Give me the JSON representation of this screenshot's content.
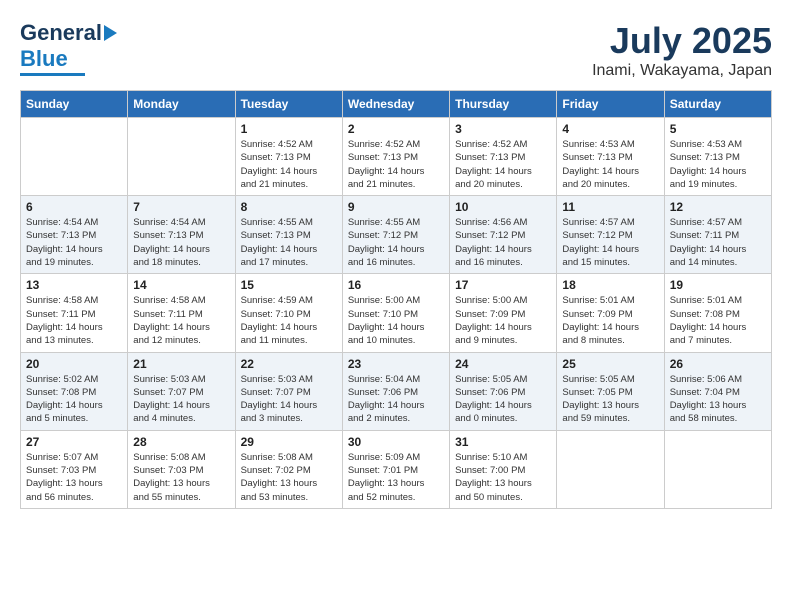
{
  "header": {
    "logo_general": "General",
    "logo_blue": "Blue",
    "month": "July 2025",
    "location": "Inami, Wakayama, Japan"
  },
  "days_of_week": [
    "Sunday",
    "Monday",
    "Tuesday",
    "Wednesday",
    "Thursday",
    "Friday",
    "Saturday"
  ],
  "weeks": [
    [
      {
        "day": "",
        "content": ""
      },
      {
        "day": "",
        "content": ""
      },
      {
        "day": "1",
        "content": "Sunrise: 4:52 AM\nSunset: 7:13 PM\nDaylight: 14 hours\nand 21 minutes."
      },
      {
        "day": "2",
        "content": "Sunrise: 4:52 AM\nSunset: 7:13 PM\nDaylight: 14 hours\nand 21 minutes."
      },
      {
        "day": "3",
        "content": "Sunrise: 4:52 AM\nSunset: 7:13 PM\nDaylight: 14 hours\nand 20 minutes."
      },
      {
        "day": "4",
        "content": "Sunrise: 4:53 AM\nSunset: 7:13 PM\nDaylight: 14 hours\nand 20 minutes."
      },
      {
        "day": "5",
        "content": "Sunrise: 4:53 AM\nSunset: 7:13 PM\nDaylight: 14 hours\nand 19 minutes."
      }
    ],
    [
      {
        "day": "6",
        "content": "Sunrise: 4:54 AM\nSunset: 7:13 PM\nDaylight: 14 hours\nand 19 minutes."
      },
      {
        "day": "7",
        "content": "Sunrise: 4:54 AM\nSunset: 7:13 PM\nDaylight: 14 hours\nand 18 minutes."
      },
      {
        "day": "8",
        "content": "Sunrise: 4:55 AM\nSunset: 7:13 PM\nDaylight: 14 hours\nand 17 minutes."
      },
      {
        "day": "9",
        "content": "Sunrise: 4:55 AM\nSunset: 7:12 PM\nDaylight: 14 hours\nand 16 minutes."
      },
      {
        "day": "10",
        "content": "Sunrise: 4:56 AM\nSunset: 7:12 PM\nDaylight: 14 hours\nand 16 minutes."
      },
      {
        "day": "11",
        "content": "Sunrise: 4:57 AM\nSunset: 7:12 PM\nDaylight: 14 hours\nand 15 minutes."
      },
      {
        "day": "12",
        "content": "Sunrise: 4:57 AM\nSunset: 7:11 PM\nDaylight: 14 hours\nand 14 minutes."
      }
    ],
    [
      {
        "day": "13",
        "content": "Sunrise: 4:58 AM\nSunset: 7:11 PM\nDaylight: 14 hours\nand 13 minutes."
      },
      {
        "day": "14",
        "content": "Sunrise: 4:58 AM\nSunset: 7:11 PM\nDaylight: 14 hours\nand 12 minutes."
      },
      {
        "day": "15",
        "content": "Sunrise: 4:59 AM\nSunset: 7:10 PM\nDaylight: 14 hours\nand 11 minutes."
      },
      {
        "day": "16",
        "content": "Sunrise: 5:00 AM\nSunset: 7:10 PM\nDaylight: 14 hours\nand 10 minutes."
      },
      {
        "day": "17",
        "content": "Sunrise: 5:00 AM\nSunset: 7:09 PM\nDaylight: 14 hours\nand 9 minutes."
      },
      {
        "day": "18",
        "content": "Sunrise: 5:01 AM\nSunset: 7:09 PM\nDaylight: 14 hours\nand 8 minutes."
      },
      {
        "day": "19",
        "content": "Sunrise: 5:01 AM\nSunset: 7:08 PM\nDaylight: 14 hours\nand 7 minutes."
      }
    ],
    [
      {
        "day": "20",
        "content": "Sunrise: 5:02 AM\nSunset: 7:08 PM\nDaylight: 14 hours\nand 5 minutes."
      },
      {
        "day": "21",
        "content": "Sunrise: 5:03 AM\nSunset: 7:07 PM\nDaylight: 14 hours\nand 4 minutes."
      },
      {
        "day": "22",
        "content": "Sunrise: 5:03 AM\nSunset: 7:07 PM\nDaylight: 14 hours\nand 3 minutes."
      },
      {
        "day": "23",
        "content": "Sunrise: 5:04 AM\nSunset: 7:06 PM\nDaylight: 14 hours\nand 2 minutes."
      },
      {
        "day": "24",
        "content": "Sunrise: 5:05 AM\nSunset: 7:06 PM\nDaylight: 14 hours\nand 0 minutes."
      },
      {
        "day": "25",
        "content": "Sunrise: 5:05 AM\nSunset: 7:05 PM\nDaylight: 13 hours\nand 59 minutes."
      },
      {
        "day": "26",
        "content": "Sunrise: 5:06 AM\nSunset: 7:04 PM\nDaylight: 13 hours\nand 58 minutes."
      }
    ],
    [
      {
        "day": "27",
        "content": "Sunrise: 5:07 AM\nSunset: 7:03 PM\nDaylight: 13 hours\nand 56 minutes."
      },
      {
        "day": "28",
        "content": "Sunrise: 5:08 AM\nSunset: 7:03 PM\nDaylight: 13 hours\nand 55 minutes."
      },
      {
        "day": "29",
        "content": "Sunrise: 5:08 AM\nSunset: 7:02 PM\nDaylight: 13 hours\nand 53 minutes."
      },
      {
        "day": "30",
        "content": "Sunrise: 5:09 AM\nSunset: 7:01 PM\nDaylight: 13 hours\nand 52 minutes."
      },
      {
        "day": "31",
        "content": "Sunrise: 5:10 AM\nSunset: 7:00 PM\nDaylight: 13 hours\nand 50 minutes."
      },
      {
        "day": "",
        "content": ""
      },
      {
        "day": "",
        "content": ""
      }
    ]
  ]
}
